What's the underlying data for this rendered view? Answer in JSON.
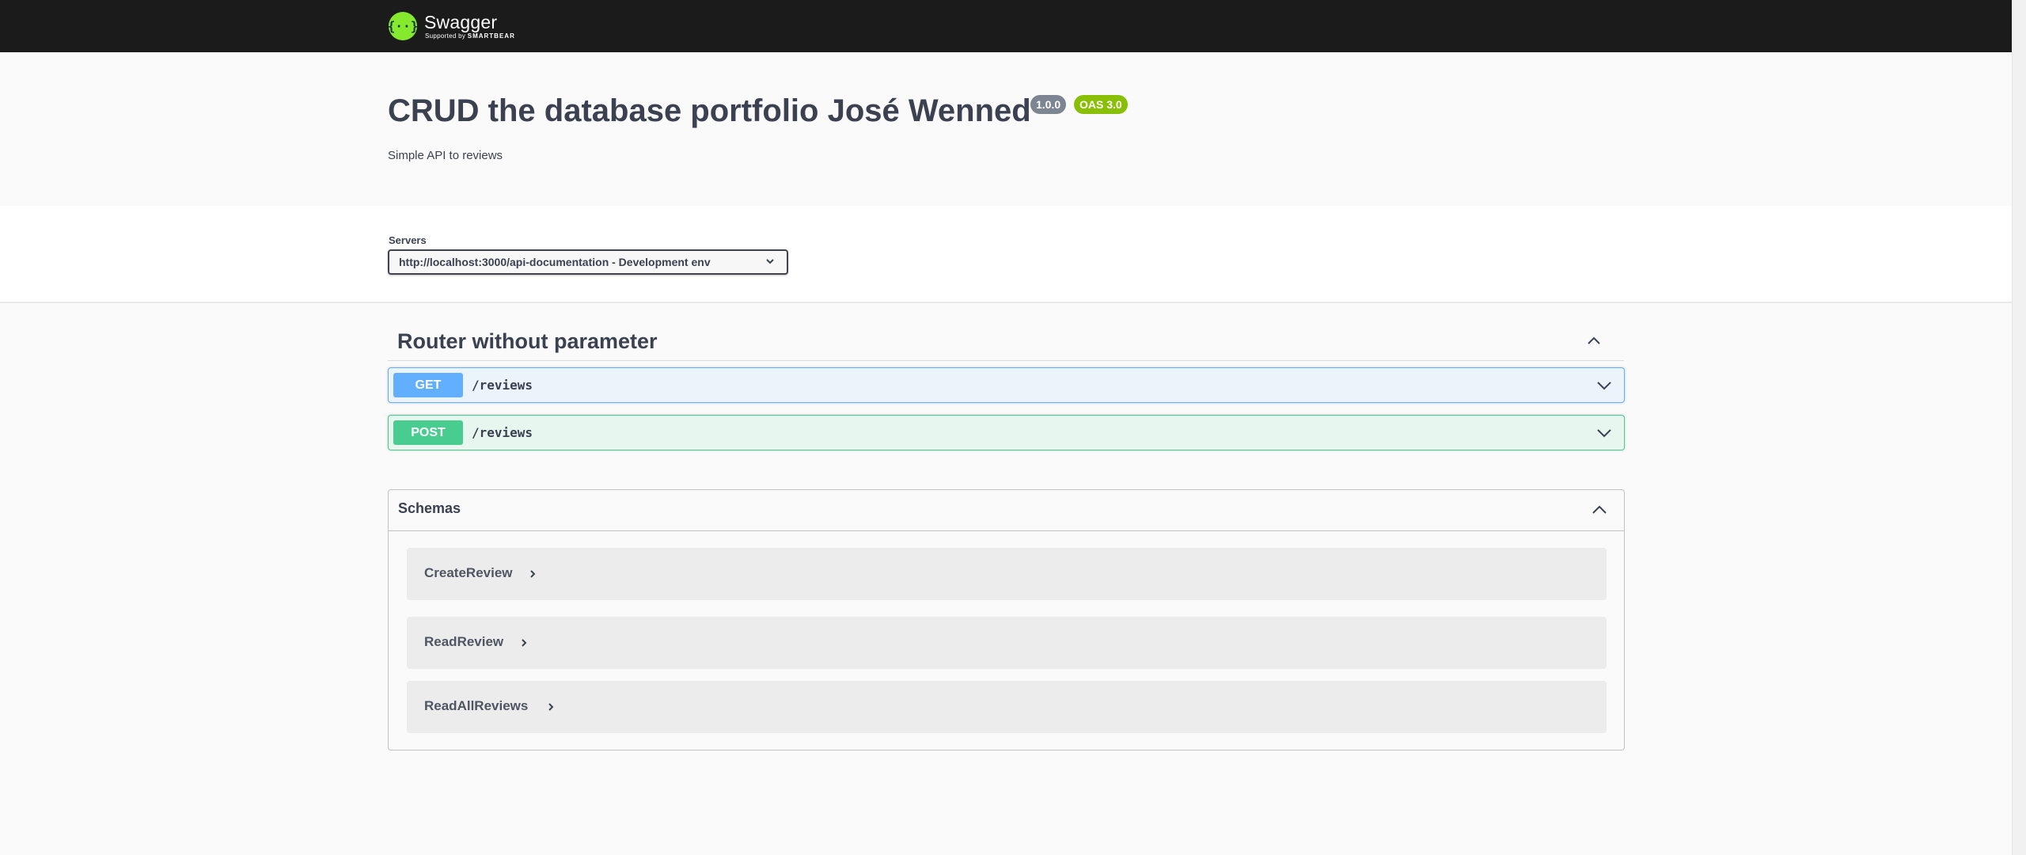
{
  "topbar": {
    "brand": "Swagger",
    "sub_prefix": "Supported by",
    "sub_brand": "SMARTBEAR",
    "logo_icon": "swagger-logo-icon",
    "bg_color": "#1b1b1b",
    "accent_color": "#85ea2d"
  },
  "info": {
    "title": "CRUD the database portfolio José Wenned",
    "version": "1.0.0",
    "oas": "OAS 3.0",
    "description": "Simple API to reviews"
  },
  "servers": {
    "label": "Servers",
    "selected": "http://localhost:3000/api-documentation - Development env",
    "icon": "chevron-down-icon"
  },
  "tag": {
    "name": "Router without parameter",
    "toggle_icon": "chevron-up-icon",
    "operations": [
      {
        "method": "GET",
        "path": "/reviews",
        "color": "#61affe"
      },
      {
        "method": "POST",
        "path": "/reviews",
        "color": "#49cc90"
      }
    ]
  },
  "schemas": {
    "title": "Schemas",
    "toggle_icon": "chevron-up-icon",
    "items": [
      {
        "name": "CreateReview"
      },
      {
        "name": "ReadReview"
      },
      {
        "name": "ReadAllReviews"
      }
    ]
  }
}
